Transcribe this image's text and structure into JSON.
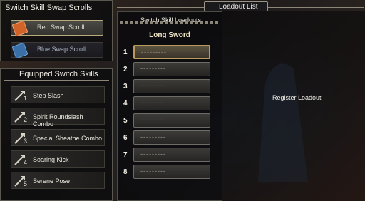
{
  "swap_scrolls": {
    "title": "Switch Skill Swap Scrolls",
    "items": [
      {
        "label": "Red Swap Scroll",
        "color": "#d2642a",
        "selected": true
      },
      {
        "label": "Blue Swap Scroll",
        "color": "#3a6fa8",
        "selected": false
      }
    ]
  },
  "equipped": {
    "title": "Equipped Switch Skills",
    "skills": [
      {
        "num": "1",
        "label": "Step Slash"
      },
      {
        "num": "2",
        "label": "Spirit Roundslash Combo"
      },
      {
        "num": "3",
        "label": "Special Sheathe Combo"
      },
      {
        "num": "4",
        "label": "Soaring Kick"
      },
      {
        "num": "5",
        "label": "Serene Pose"
      }
    ]
  },
  "loadouts": {
    "title": "Switch Skill Loadouts",
    "weapon": "Long Sword",
    "rows": [
      {
        "num": "1",
        "text": "---------",
        "selected": true
      },
      {
        "num": "2",
        "text": "---------",
        "selected": false
      },
      {
        "num": "3",
        "text": "---------",
        "selected": false
      },
      {
        "num": "4",
        "text": "---------",
        "selected": false
      },
      {
        "num": "5",
        "text": "---------",
        "selected": false
      },
      {
        "num": "6",
        "text": "---------",
        "selected": false
      },
      {
        "num": "7",
        "text": "---------",
        "selected": false
      },
      {
        "num": "8",
        "text": "---------",
        "selected": false
      }
    ]
  },
  "loadout_list": {
    "title": "Loadout List",
    "action": "Register Loadout"
  }
}
